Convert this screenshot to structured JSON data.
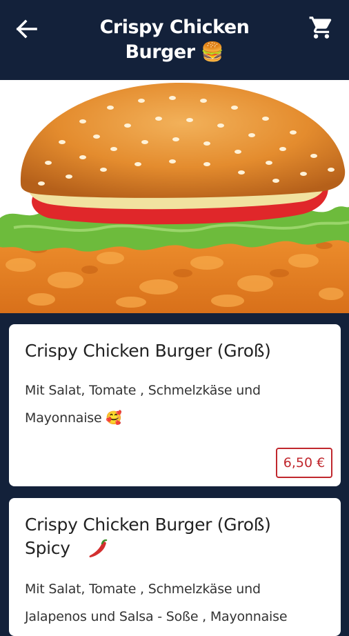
{
  "header": {
    "title_line1": "Crispy Chicken",
    "title_line2": "Burger 🍔",
    "back_icon": "arrow-left-icon",
    "cart_icon": "shopping-cart-icon"
  },
  "hero": {
    "image": "crispy-chicken-burger-photo"
  },
  "products": [
    {
      "name": "Crispy Chicken Burger (Groß)",
      "desc_line1": "Mit Salat, Tomate , Schmelzkäse und",
      "desc_line2": "Mayonnaise 🥰",
      "price": "6,50 €"
    },
    {
      "name_line1": "Crispy Chicken Burger (Groß)",
      "name_line2": "Spicy",
      "icon": "chili-pepper-icon",
      "desc_line1": "Mit Salat, Tomate , Schmelzkäse und",
      "desc_line2": "Jalapenos und Salsa - Soße , Mayonnaise"
    }
  ],
  "colors": {
    "background": "#13213a",
    "card": "#ffffff",
    "price_accent": "#c0272d"
  }
}
